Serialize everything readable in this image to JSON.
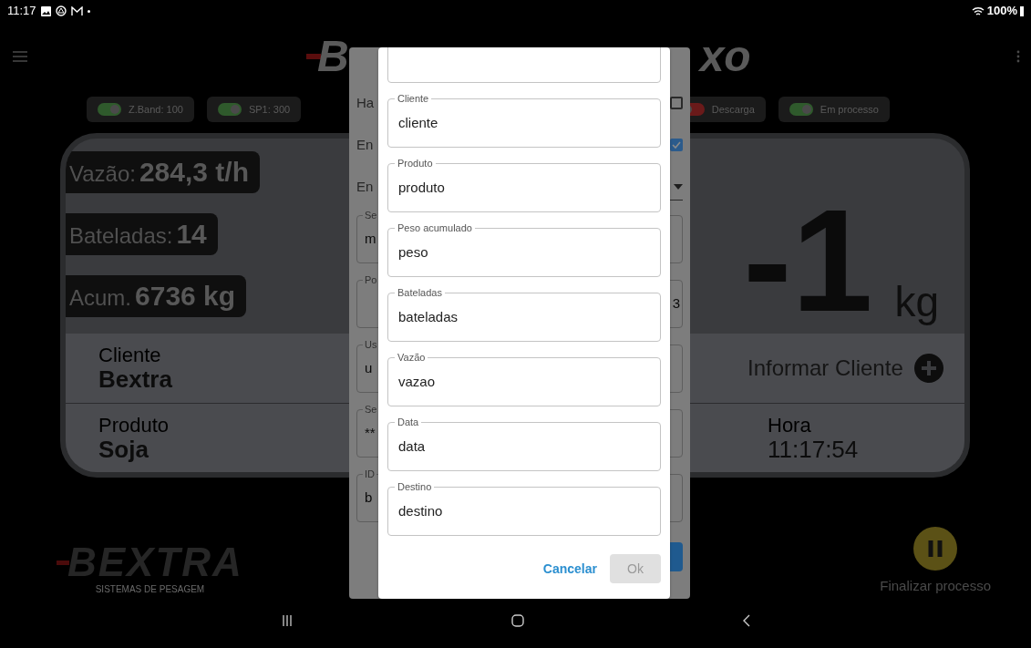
{
  "status_bar": {
    "time": "11:17",
    "battery": "100%"
  },
  "header": {
    "title_left": "B",
    "title_right": "xo"
  },
  "indicators": [
    {
      "label": "Z.Band: 100",
      "on": true
    },
    {
      "label": "SP1: 300",
      "on": true
    },
    {
      "label": "Descarga",
      "on": false
    },
    {
      "label": "Em processo",
      "on": true
    }
  ],
  "readouts": [
    {
      "label": "Vazão:",
      "value": "284,3 t/h"
    },
    {
      "label": "Bateladas:",
      "value": "14"
    },
    {
      "label": "Acum.",
      "value": "6736 kg"
    }
  ],
  "weight": {
    "value": "-1",
    "unit": "kg"
  },
  "info_rows": [
    {
      "label": "Cliente",
      "value": "Bextra"
    },
    {
      "label": "Produto",
      "value": "Soja"
    }
  ],
  "inform_client_button": "Informar Cliente",
  "time_info": {
    "label": "Hora",
    "value": "11:17:54"
  },
  "logo": {
    "name": "BEXTRA",
    "tagline": "SISTEMAS DE PESAGEM"
  },
  "finish_button": {
    "label": "Finalizar processo"
  },
  "settings_dialog": {
    "rows": [
      {
        "kind": "checkbox",
        "label": "Ha",
        "checked": false
      },
      {
        "kind": "checkbox",
        "label": "En",
        "checked": true
      },
      {
        "kind": "select",
        "label": "En"
      },
      {
        "kind": "field",
        "label": "Se",
        "value": "m"
      },
      {
        "kind": "field_right",
        "label": "Po",
        "value": "3"
      },
      {
        "kind": "field",
        "label": "Us",
        "value": "u"
      },
      {
        "kind": "field",
        "label": "Se",
        "value": "**"
      },
      {
        "kind": "field",
        "label": "ID",
        "value": "b"
      }
    ]
  },
  "export_dialog": {
    "fields": [
      {
        "label": "Cliente",
        "value": "cliente"
      },
      {
        "label": "Produto",
        "value": "produto"
      },
      {
        "label": "Peso acumulado",
        "value": "peso"
      },
      {
        "label": "Bateladas",
        "value": "bateladas"
      },
      {
        "label": "Vazão",
        "value": "vazao"
      },
      {
        "label": "Data",
        "value": "data"
      },
      {
        "label": "Destino",
        "value": "destino"
      }
    ],
    "cancel": "Cancelar",
    "ok": {
      "label": "Ok",
      "disabled": true
    }
  }
}
